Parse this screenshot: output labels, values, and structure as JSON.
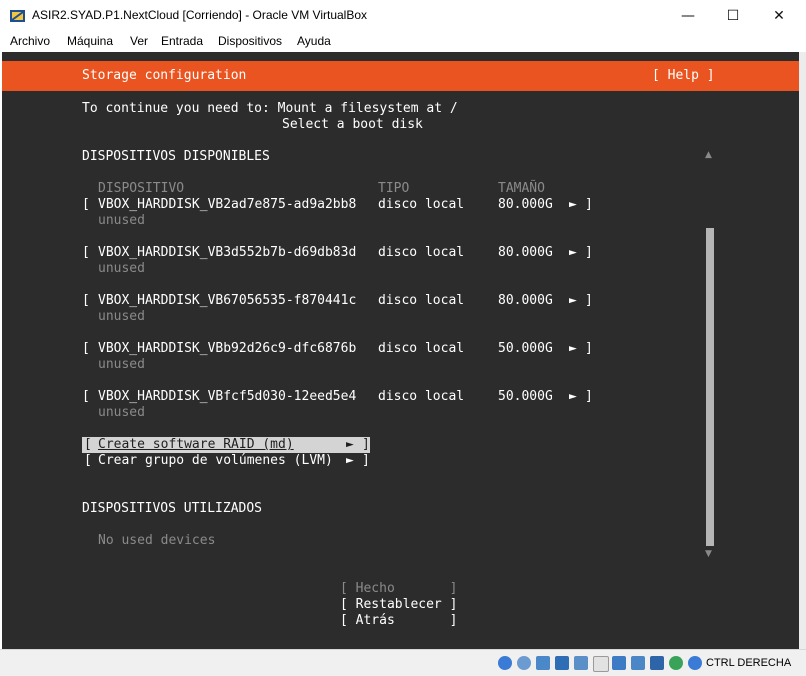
{
  "window": {
    "title": "ASIR2.SYAD.P1.NextCloud [Corriendo] - Oracle VM VirtualBox",
    "controls": {
      "minimize": "—",
      "maximize": "☐",
      "close": "✕"
    }
  },
  "menu": [
    "Archivo",
    "Máquina",
    "Ver",
    "Entrada",
    "Dispositivos",
    "Ayuda"
  ],
  "screen": {
    "header_title": "Storage configuration",
    "help": "[ Help ]",
    "instructions_line1": "To continue you need to: Mount a filesystem at /",
    "instructions_line2": "Select a boot disk",
    "available_heading": "DISPOSITIVOS DISPONIBLES",
    "columns": {
      "device": "DISPOSITIVO",
      "type": "TIPO",
      "size": "TAMAÑO"
    },
    "devices": [
      {
        "name": "VBOX_HARDDISK_VB2ad7e875-ad9a2bb8",
        "type": "disco local",
        "size": "80.000G",
        "status": "unused"
      },
      {
        "name": "VBOX_HARDDISK_VB3d552b7b-d69db83d",
        "type": "disco local",
        "size": "80.000G",
        "status": "unused"
      },
      {
        "name": "VBOX_HARDDISK_VB67056535-f870441c",
        "type": "disco local",
        "size": "80.000G",
        "status": "unused"
      },
      {
        "name": "VBOX_HARDDISK_VBb92d26c9-dfc6876b",
        "type": "disco local",
        "size": "50.000G",
        "status": "unused"
      },
      {
        "name": "VBOX_HARDDISK_VBfcf5d030-12eed5e4",
        "type": "disco local",
        "size": "50.000G",
        "status": "unused"
      }
    ],
    "bracket_open": "[",
    "bracket_close": "]",
    "arrow": "►",
    "raid_action": "Create software RAID (md)",
    "lvm_action": "Crear grupo de volúmenes (LVM)",
    "used_heading": "DISPOSITIVOS UTILIZADOS",
    "no_used": "No used devices",
    "buttons": {
      "done": "[ Hecho       ]",
      "reset": "[ Restablecer ]",
      "back": "[ Atrás       ]"
    }
  },
  "statusbar": {
    "host_key": "CTRL DERECHA"
  }
}
